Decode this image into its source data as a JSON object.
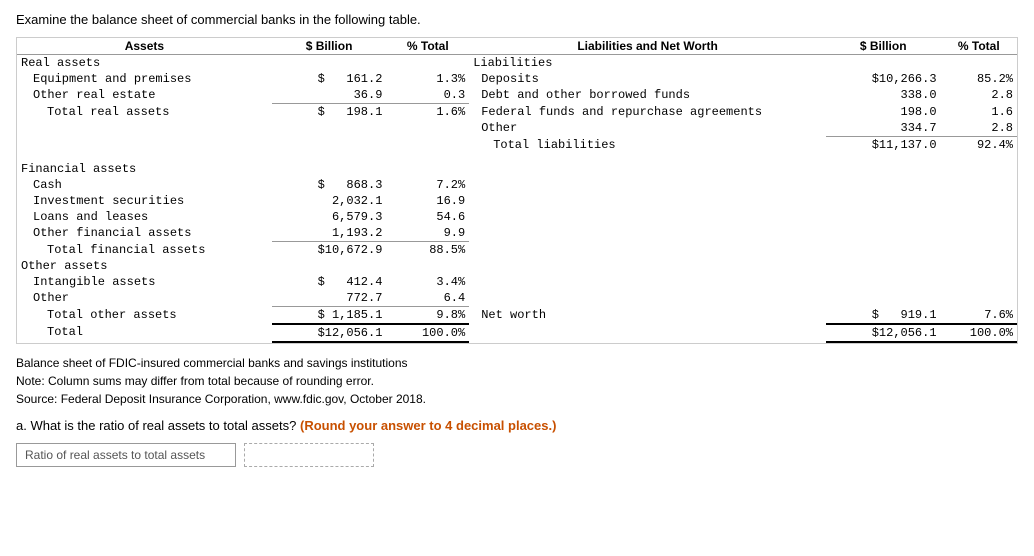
{
  "intro": "Examine the balance sheet of commercial banks in the following table.",
  "table": {
    "assets_header": "Assets",
    "billion_header": "$ Billion",
    "total_header": "% Total",
    "liab_header": "Liabilities and Net Worth",
    "lbillion_header": "$ Billion",
    "ltotal_header": "% Total",
    "sections": {
      "real_assets": {
        "label": "Real assets",
        "rows": [
          {
            "name": "Equipment and premises",
            "billion": "$   161.2",
            "total": "1.3%"
          },
          {
            "name": "Other real estate",
            "billion": "36.9",
            "total": "0.3"
          },
          {
            "name": "Total real assets",
            "billion": "$   198.1",
            "total": "1.6%",
            "total_row": true
          }
        ]
      },
      "financial_assets": {
        "label": "Financial assets",
        "rows": [
          {
            "name": "Cash",
            "billion": "$   868.3",
            "total": "7.2%"
          },
          {
            "name": "Investment securities",
            "billion": "2,032.1",
            "total": "16.9"
          },
          {
            "name": "Loans and leases",
            "billion": "6,579.3",
            "total": "54.6"
          },
          {
            "name": "Other financial assets",
            "billion": "1,193.2",
            "total": "9.9"
          },
          {
            "name": "Total financial assets",
            "billion": "$10,672.9",
            "total": "88.5%",
            "total_row": true
          }
        ]
      },
      "other_assets": {
        "label": "Other assets",
        "rows": [
          {
            "name": "Intangible assets",
            "billion": "$   412.4",
            "total": "3.4%"
          },
          {
            "name": "Other",
            "billion": "772.7",
            "total": "6.4"
          },
          {
            "name": "Total other assets",
            "billion": "$ 1,185.1",
            "total": "9.8%",
            "total_row": true
          }
        ]
      },
      "total_row": {
        "name": "Total",
        "billion": "$12,056.1",
        "total": "100.0%"
      }
    },
    "liabilities": {
      "label": "Liabilities",
      "rows": [
        {
          "name": "Deposits",
          "billion": "$10,266.3",
          "total": "85.2%"
        },
        {
          "name": "Debt and other borrowed funds",
          "billion": "338.0",
          "total": "2.8"
        },
        {
          "name": "Federal funds and repurchase agreements",
          "billion": "198.0",
          "total": "1.6"
        },
        {
          "name": "Other",
          "billion": "334.7",
          "total": "2.8"
        },
        {
          "name": "Total liabilities",
          "billion": "$11,137.0",
          "total": "92.4%",
          "total_row": true
        }
      ]
    },
    "net_worth": {
      "label": "Net worth",
      "billion": "$   919.1",
      "total": "7.6%"
    },
    "total_liab": {
      "billion": "$12,056.1",
      "total": "100.0%"
    }
  },
  "notes": [
    "Balance sheet of FDIC-insured commercial banks and savings institutions",
    "Note: Column sums may differ from total because of rounding error.",
    "Source: Federal Deposit Insurance Corporation, www.fdic.gov, October 2018."
  ],
  "question": {
    "prefix": "a. What is the ratio of real assets to total assets?",
    "highlighted": "(Round your answer to 4 decimal places.)"
  },
  "answer": {
    "label": "Ratio of real assets to total assets",
    "placeholder": ""
  }
}
